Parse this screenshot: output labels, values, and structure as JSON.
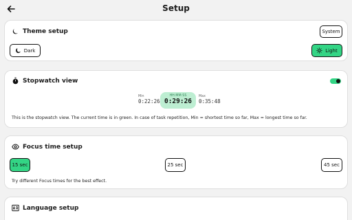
{
  "header": {
    "title": "Setup",
    "back_icon": "arrow-left-icon"
  },
  "theme_setup": {
    "title": "Theme setup",
    "icon": "moon-icon",
    "system_label": "System",
    "dark_label": "Dark",
    "light_label": "Light",
    "selected": "Light"
  },
  "stopwatch_view": {
    "title": "Stopwatch view",
    "icon": "stopwatch-icon",
    "toggle_on": true,
    "min_label": "Min",
    "min_time": "0:22:26",
    "current_label": "HH:MM:SS",
    "current_time": "0:29:26",
    "max_label": "Max",
    "max_time": "0:35:48",
    "description": "This is the stopwatch view. The current time is in green. In case of task repetition, Min = shortest time so far, Max = longest time so far."
  },
  "focus_time_setup": {
    "title": "Focus time setup",
    "icon": "eye-icon",
    "options": [
      "15 sec",
      "25 sec",
      "45 sec"
    ],
    "selected": "15 sec",
    "description": "Try different Focus times for the best effect."
  },
  "language_setup": {
    "title": "Language setup",
    "icon": "translate-icon"
  },
  "colors": {
    "accent": "#33d585",
    "current_bg": "#bdeed2",
    "background": "#f2f2f2"
  }
}
